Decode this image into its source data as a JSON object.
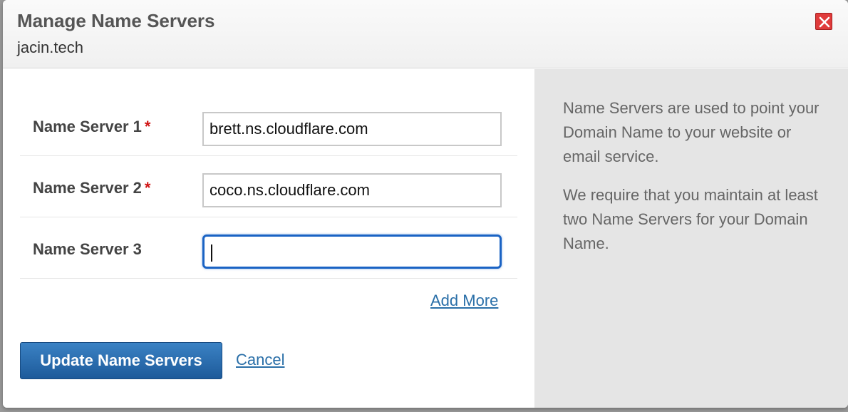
{
  "dialog": {
    "title": "Manage Name Servers",
    "subtitle": "jacin.tech",
    "close_icon": "close-icon"
  },
  "form": {
    "rows": [
      {
        "label": "Name Server 1",
        "required": "*",
        "value": "brett.ns.cloudflare.com"
      },
      {
        "label": "Name Server 2",
        "required": "*",
        "value": "coco.ns.cloudflare.com"
      },
      {
        "label": "Name Server 3",
        "required": "",
        "value": ""
      }
    ],
    "add_more_label": "Add More",
    "submit_label": "Update Name Servers",
    "cancel_label": "Cancel"
  },
  "help": {
    "paragraph1": "Name Servers are used to point your Domain Name to your website or email service.",
    "paragraph2": "We require that you maintain at least two Name Servers for your Domain Name."
  },
  "colors": {
    "primary_button": "#1d5a9a",
    "link": "#2a6fa8",
    "required_asterisk": "#d01414",
    "close_button": "#e03b3b",
    "focus_ring": "#1a63c4"
  }
}
